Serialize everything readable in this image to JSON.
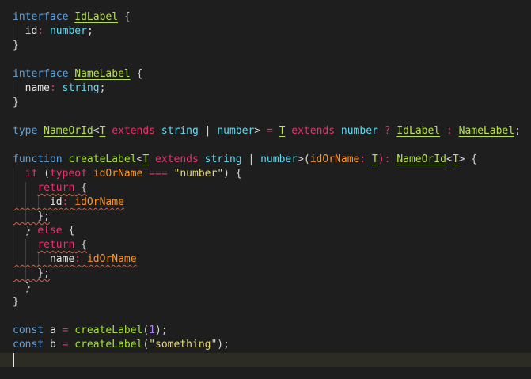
{
  "editor": {
    "language": "typescript",
    "colors": {
      "background": "#1e1e1e",
      "keyword_blue": "#569cd6",
      "keyword_pink": "#e6336b",
      "type_name": "#b5e04a",
      "type_param": "#a6e22e",
      "property": "#e6e6e6",
      "builtin_type": "#66d9ef",
      "operator": "#e6336b",
      "string": "#e6db74",
      "number": "#ae81ff",
      "variable": "#fd971f",
      "function": "#a6e22e",
      "error_squiggle": "#e05a3a"
    },
    "lines": [
      [
        {
          "t": "interface ",
          "c": "#5ea3e0"
        },
        {
          "t": "IdLabel",
          "c": "#b5e04a",
          "u": true
        },
        {
          "t": " {",
          "c": "#d4d4d4"
        }
      ],
      [
        {
          "t": "  id",
          "c": "#e6e6e6"
        },
        {
          "t": ": ",
          "c": "#e6336b"
        },
        {
          "t": "number",
          "c": "#66d9ef"
        },
        {
          "t": ";",
          "c": "#d4d4d4"
        }
      ],
      [
        {
          "t": "}",
          "c": "#d4d4d4"
        }
      ],
      [],
      [
        {
          "t": "interface ",
          "c": "#5ea3e0"
        },
        {
          "t": "NameLabel",
          "c": "#b5e04a",
          "u": true
        },
        {
          "t": " {",
          "c": "#d4d4d4"
        }
      ],
      [
        {
          "t": "  name",
          "c": "#e6e6e6"
        },
        {
          "t": ": ",
          "c": "#e6336b"
        },
        {
          "t": "string",
          "c": "#66d9ef"
        },
        {
          "t": ";",
          "c": "#d4d4d4"
        }
      ],
      [
        {
          "t": "}",
          "c": "#d4d4d4"
        }
      ],
      [],
      [
        {
          "t": "type ",
          "c": "#5ea3e0"
        },
        {
          "t": "NameOrId",
          "c": "#b5e04a",
          "u": true
        },
        {
          "t": "<",
          "c": "#d4d4d4"
        },
        {
          "t": "T",
          "c": "#b5e04a",
          "u": true
        },
        {
          "t": " extends ",
          "c": "#e6336b"
        },
        {
          "t": "string",
          "c": "#66d9ef"
        },
        {
          "t": " | ",
          "c": "#d4d4d4"
        },
        {
          "t": "number",
          "c": "#66d9ef"
        },
        {
          "t": "> ",
          "c": "#d4d4d4"
        },
        {
          "t": "= ",
          "c": "#e6336b"
        },
        {
          "t": "T",
          "c": "#b5e04a",
          "u": true
        },
        {
          "t": " extends ",
          "c": "#e6336b"
        },
        {
          "t": "number",
          "c": "#66d9ef"
        },
        {
          "t": " ? ",
          "c": "#e6336b"
        },
        {
          "t": "IdLabel",
          "c": "#b5e04a",
          "u": true
        },
        {
          "t": " : ",
          "c": "#e6336b"
        },
        {
          "t": "NameLabel",
          "c": "#b5e04a",
          "u": true
        },
        {
          "t": ";",
          "c": "#d4d4d4"
        }
      ],
      [],
      [
        {
          "t": "function ",
          "c": "#5ea3e0"
        },
        {
          "t": "createLabel",
          "c": "#a6e22e"
        },
        {
          "t": "<",
          "c": "#d4d4d4"
        },
        {
          "t": "T",
          "c": "#b5e04a",
          "u": true
        },
        {
          "t": " extends ",
          "c": "#e6336b"
        },
        {
          "t": "string",
          "c": "#66d9ef"
        },
        {
          "t": " | ",
          "c": "#d4d4d4"
        },
        {
          "t": "number",
          "c": "#66d9ef"
        },
        {
          "t": ">(",
          "c": "#d4d4d4"
        },
        {
          "t": "idOrName",
          "c": "#fd971f"
        },
        {
          "t": ": ",
          "c": "#e6336b"
        },
        {
          "t": "T",
          "c": "#b5e04a",
          "u": true
        },
        {
          "t": "): ",
          "c": "#e6336b"
        },
        {
          "t": "NameOrId",
          "c": "#b5e04a",
          "u": true
        },
        {
          "t": "<",
          "c": "#d4d4d4"
        },
        {
          "t": "T",
          "c": "#b5e04a",
          "u": true
        },
        {
          "t": "> {",
          "c": "#d4d4d4"
        }
      ],
      [
        {
          "t": "  if ",
          "c": "#e6336b"
        },
        {
          "t": "(",
          "c": "#d4d4d4"
        },
        {
          "t": "typeof ",
          "c": "#e6336b"
        },
        {
          "t": "idOrName",
          "c": "#fd971f"
        },
        {
          "t": " === ",
          "c": "#e6336b"
        },
        {
          "t": "\"number\"",
          "c": "#e6db74"
        },
        {
          "t": ") {",
          "c": "#d4d4d4"
        }
      ],
      [
        {
          "t": "    "
        },
        {
          "t": "return",
          "c": "#e6336b",
          "s": true
        },
        {
          "t": " {",
          "c": "#d4d4d4",
          "s": true
        }
      ],
      [
        {
          "t": "      id",
          "c": "#e6e6e6",
          "s": true
        },
        {
          "t": ": ",
          "c": "#e6336b",
          "s": true
        },
        {
          "t": "idOrName",
          "c": "#fd971f",
          "s": true
        }
      ],
      [
        {
          "t": "    };",
          "c": "#d4d4d4",
          "s": true
        }
      ],
      [
        {
          "t": "  } ",
          "c": "#d4d4d4"
        },
        {
          "t": "else",
          "c": "#e6336b"
        },
        {
          "t": " {",
          "c": "#d4d4d4"
        }
      ],
      [
        {
          "t": "    "
        },
        {
          "t": "return",
          "c": "#e6336b",
          "s": true
        },
        {
          "t": " {",
          "c": "#d4d4d4",
          "s": true
        }
      ],
      [
        {
          "t": "      name",
          "c": "#e6e6e6",
          "s": true
        },
        {
          "t": ": ",
          "c": "#e6336b",
          "s": true
        },
        {
          "t": "idOrName",
          "c": "#fd971f",
          "s": true
        }
      ],
      [
        {
          "t": "    };",
          "c": "#d4d4d4",
          "s": true
        }
      ],
      [
        {
          "t": "  }",
          "c": "#d4d4d4"
        }
      ],
      [
        {
          "t": "}",
          "c": "#d4d4d4"
        }
      ],
      [],
      [
        {
          "t": "const ",
          "c": "#5ea3e0"
        },
        {
          "t": "a",
          "c": "#e6e6e6"
        },
        {
          "t": " = ",
          "c": "#e6336b"
        },
        {
          "t": "createLabel",
          "c": "#a6e22e"
        },
        {
          "t": "(",
          "c": "#d4d4d4"
        },
        {
          "t": "1",
          "c": "#ae81ff"
        },
        {
          "t": ");",
          "c": "#d4d4d4"
        }
      ],
      [
        {
          "t": "const ",
          "c": "#5ea3e0"
        },
        {
          "t": "b",
          "c": "#e6e6e6"
        },
        {
          "t": " = ",
          "c": "#e6336b"
        },
        {
          "t": "createLabel",
          "c": "#a6e22e"
        },
        {
          "t": "(",
          "c": "#d4d4d4"
        },
        {
          "t": "\"something\"",
          "c": "#e6db74"
        },
        {
          "t": ");",
          "c": "#d4d4d4"
        }
      ],
      []
    ]
  }
}
